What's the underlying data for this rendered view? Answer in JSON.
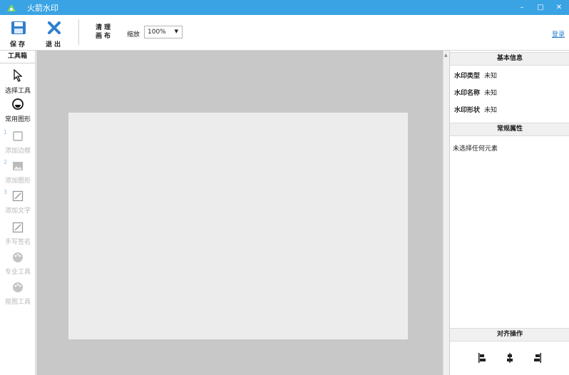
{
  "window": {
    "title": "火箭水印",
    "controls": [
      "–",
      "□",
      "✕"
    ]
  },
  "toolbar": {
    "save_label": "保存",
    "exit_label": "退出",
    "clear_label": "清理画布",
    "zoom_label": "缩放",
    "zoom_value": "100%",
    "login_label": "登录"
  },
  "toolbox": {
    "title": "工具箱",
    "items": [
      {
        "label": "选择工具",
        "icon": "cursor-icon",
        "enabled": true,
        "number": ""
      },
      {
        "label": "常用图形",
        "icon": "shape-icon",
        "enabled": true,
        "number": ""
      },
      {
        "label": "添加边框",
        "icon": "border-icon",
        "enabled": false,
        "number": "1"
      },
      {
        "label": "添加图形",
        "icon": "image-icon",
        "enabled": false,
        "number": "2"
      },
      {
        "label": "添加文字",
        "icon": "text-icon",
        "enabled": false,
        "number": "3"
      },
      {
        "label": "手写签名",
        "icon": "signature-icon",
        "enabled": false,
        "number": ""
      },
      {
        "label": "专业工具",
        "icon": "palette-icon",
        "enabled": false,
        "number": ""
      },
      {
        "label": "抠图工具",
        "icon": "palette-icon",
        "enabled": false,
        "number": ""
      }
    ]
  },
  "right_panel": {
    "basic_info_title": "基本信息",
    "basic_info": [
      {
        "key": "水印类型",
        "value": "未知"
      },
      {
        "key": "水印名称",
        "value": "未知"
      },
      {
        "key": "水印形状",
        "value": "未知"
      }
    ],
    "props_title": "常规属性",
    "props_empty": "未选择任何元素",
    "align_title": "对齐操作"
  },
  "colors": {
    "titlebar": "#3aa3e3",
    "save_icon": "#2f7fcf",
    "exit_icon": "#2f7fcf",
    "workspace": "#c8c8c8",
    "canvas": "#ececec"
  }
}
